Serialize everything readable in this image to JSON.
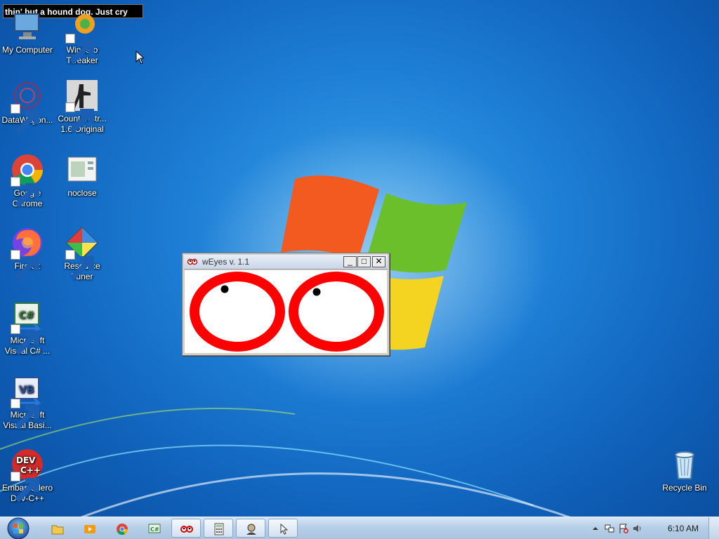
{
  "ticker": {
    "text": "thin' but a hound dog. Just cry"
  },
  "desktop_icons": [
    {
      "label": "My Computer"
    },
    {
      "label": "Winaero Tweaker"
    },
    {
      "label": "DataWagon..."
    },
    {
      "label": "Counter-str... 1.6 Original"
    },
    {
      "label": "Google Chrome"
    },
    {
      "label": "noclose"
    },
    {
      "label": "Firefox"
    },
    {
      "label": "Resource Tuner"
    },
    {
      "label": "Microsoft Visual C# ..."
    },
    {
      "label": "Microsoft Visual Basi..."
    },
    {
      "label": "Embarcadero Dev-C++"
    },
    {
      "label": "Recycle Bin"
    }
  ],
  "weyes_window": {
    "title": "wEyes v. 1.1",
    "minimize_label": "_",
    "maximize_label": "□",
    "close_label": "✕",
    "eye_color": "#ff0000",
    "pupil_color": "#000000"
  },
  "taskbar": {
    "clock": "6:10 AM",
    "items": [
      {
        "icon": "explorer-folder-icon"
      },
      {
        "icon": "media-player-icon"
      },
      {
        "icon": "chrome-icon"
      },
      {
        "icon": "visual-csharp-icon"
      },
      {
        "icon": "weyes-icon"
      },
      {
        "icon": "calculator-icon"
      },
      {
        "icon": "user-avatar-icon"
      },
      {
        "icon": "mouse-pointer-app-icon"
      }
    ]
  },
  "colors": {
    "accent": "#1e7fd6",
    "taskbar": "#b7cfe8"
  }
}
